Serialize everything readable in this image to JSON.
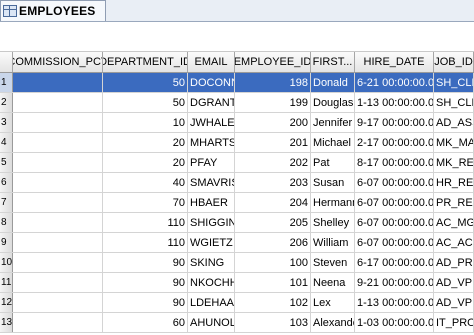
{
  "tab": {
    "label": "EMPLOYEES"
  },
  "columns": [
    "COMMISSION_PCT",
    "DEPARTMENT_ID",
    "EMAIL",
    "EMPLOYEE_ID",
    "FIRST...",
    "HIRE_DATE",
    "JOB_ID"
  ],
  "rows": [
    {
      "num": "1",
      "commission": "",
      "department_id": "50",
      "email": "DOCONNI",
      "employee_id": "198",
      "first_name": "Donald",
      "hire_date": "6-21 00:00:00.0",
      "job_id": "SH_CLERI"
    },
    {
      "num": "2",
      "commission": "",
      "department_id": "50",
      "email": "DGRANT",
      "employee_id": "199",
      "first_name": "Douglas",
      "hire_date": "1-13 00:00:00.0",
      "job_id": "SH_CLERI"
    },
    {
      "num": "3",
      "commission": "",
      "department_id": "10",
      "email": "JWHALEN",
      "employee_id": "200",
      "first_name": "Jennifer",
      "hire_date": "9-17 00:00:00.0",
      "job_id": "AD_ASST"
    },
    {
      "num": "4",
      "commission": "",
      "department_id": "20",
      "email": "MHARTST",
      "employee_id": "201",
      "first_name": "Michael",
      "hire_date": "2-17 00:00:00.0",
      "job_id": "MK_MAN"
    },
    {
      "num": "5",
      "commission": "",
      "department_id": "20",
      "email": "PFAY",
      "employee_id": "202",
      "first_name": "Pat",
      "hire_date": "8-17 00:00:00.0",
      "job_id": "MK_REP"
    },
    {
      "num": "6",
      "commission": "",
      "department_id": "40",
      "email": "SMAVRIS",
      "employee_id": "203",
      "first_name": "Susan",
      "hire_date": "6-07 00:00:00.0",
      "job_id": "HR_REP"
    },
    {
      "num": "7",
      "commission": "",
      "department_id": "70",
      "email": "HBAER",
      "employee_id": "204",
      "first_name": "Hermann",
      "hire_date": "6-07 00:00:00.0",
      "job_id": "PR_REP"
    },
    {
      "num": "8",
      "commission": "",
      "department_id": "110",
      "email": "SHIGGINS",
      "employee_id": "205",
      "first_name": "Shelley",
      "hire_date": "6-07 00:00:00.0",
      "job_id": "AC_MGR"
    },
    {
      "num": "9",
      "commission": "",
      "department_id": "110",
      "email": "WGIETZ",
      "employee_id": "206",
      "first_name": "William",
      "hire_date": "6-07 00:00:00.0",
      "job_id": "AC_ACCO"
    },
    {
      "num": "10",
      "commission": "",
      "department_id": "90",
      "email": "SKING",
      "employee_id": "100",
      "first_name": "Steven",
      "hire_date": "6-17 00:00:00.0",
      "job_id": "AD_PRES"
    },
    {
      "num": "11",
      "commission": "",
      "department_id": "90",
      "email": "NKOCHHA",
      "employee_id": "101",
      "first_name": "Neena",
      "hire_date": "9-21 00:00:00.0",
      "job_id": "AD_VP"
    },
    {
      "num": "12",
      "commission": "",
      "department_id": "90",
      "email": "LDEHAAN",
      "employee_id": "102",
      "first_name": "Lex",
      "hire_date": "1-13 00:00:00.0",
      "job_id": "AD_VP"
    },
    {
      "num": "13",
      "commission": "",
      "department_id": "60",
      "email": "AHUNOLD",
      "employee_id": "103",
      "first_name": "Alexande",
      "hire_date": "1-03 00:00:00.0",
      "job_id": "IT_PROG"
    }
  ]
}
